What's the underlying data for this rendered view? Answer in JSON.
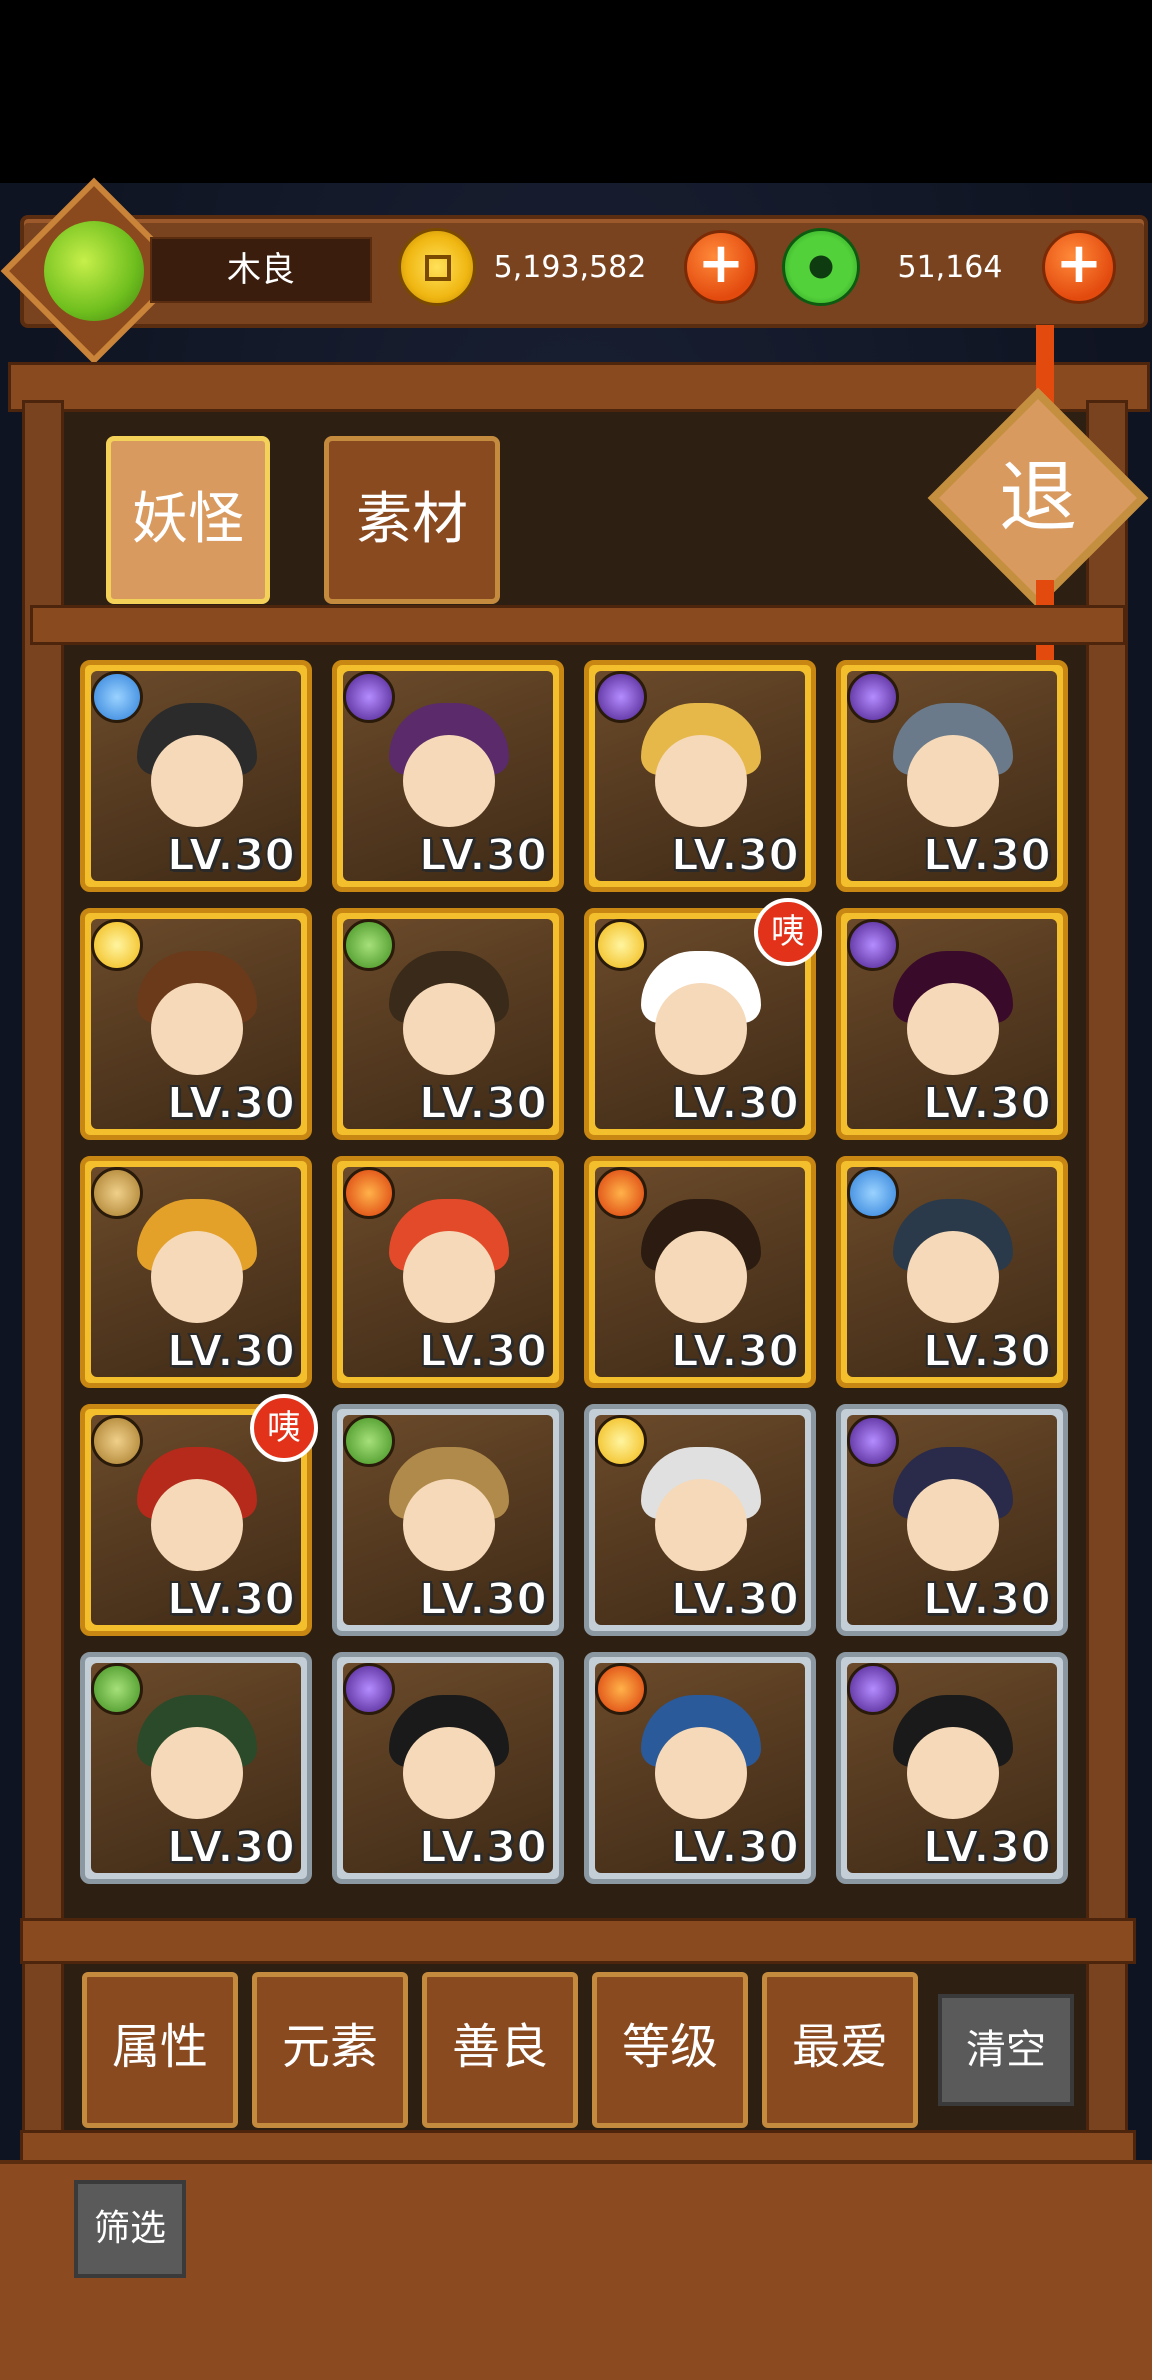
{
  "player": {
    "name": "木良",
    "gold": "5,193,582",
    "jade": "51,164"
  },
  "tabs": [
    {
      "label": "妖怪",
      "active": true
    },
    {
      "label": "素材",
      "active": false
    }
  ],
  "exit_label": "退",
  "level_label": "LV.30",
  "cards": [
    {
      "element": "water",
      "frame": "gold",
      "hair": "#2b2b2b"
    },
    {
      "element": "dark",
      "frame": "gold",
      "hair": "#5a2a6a"
    },
    {
      "element": "dark",
      "frame": "gold",
      "hair": "#e6b84a"
    },
    {
      "element": "dark",
      "frame": "gold",
      "hair": "#6a7a8a"
    },
    {
      "element": "light",
      "frame": "gold",
      "hair": "#6a3a1a"
    },
    {
      "element": "wood",
      "frame": "gold",
      "hair": "#3a2a1a"
    },
    {
      "element": "light",
      "frame": "gold",
      "hair": "#ffffff",
      "badge": "咦"
    },
    {
      "element": "dark",
      "frame": "gold",
      "hair": "#3a0a2a"
    },
    {
      "element": "earth",
      "frame": "gold",
      "hair": "#e3a12a"
    },
    {
      "element": "fire",
      "frame": "gold",
      "hair": "#e34a2a"
    },
    {
      "element": "fire",
      "frame": "gold",
      "hair": "#2b1b10"
    },
    {
      "element": "water",
      "frame": "gold",
      "hair": "#2a3a4a"
    },
    {
      "element": "earth",
      "frame": "gold",
      "hair": "#b52a1a",
      "badge": "咦"
    },
    {
      "element": "wood",
      "frame": "silver",
      "hair": "#b08a4a"
    },
    {
      "element": "light",
      "frame": "silver",
      "hair": "#e0e0e0"
    },
    {
      "element": "dark",
      "frame": "silver",
      "hair": "#2a2a4a"
    },
    {
      "element": "wood",
      "frame": "silver",
      "hair": "#2a4a2a"
    },
    {
      "element": "dark",
      "frame": "silver",
      "hair": "#1a1a1a"
    },
    {
      "element": "fire",
      "frame": "silver",
      "hair": "#2a5a9a"
    },
    {
      "element": "dark",
      "frame": "silver",
      "hair": "#1a1a1a"
    }
  ],
  "filters": [
    "属性",
    "元素",
    "善良",
    "等级",
    "最爱"
  ],
  "clear_label": "清空",
  "sift_label": "筛选"
}
